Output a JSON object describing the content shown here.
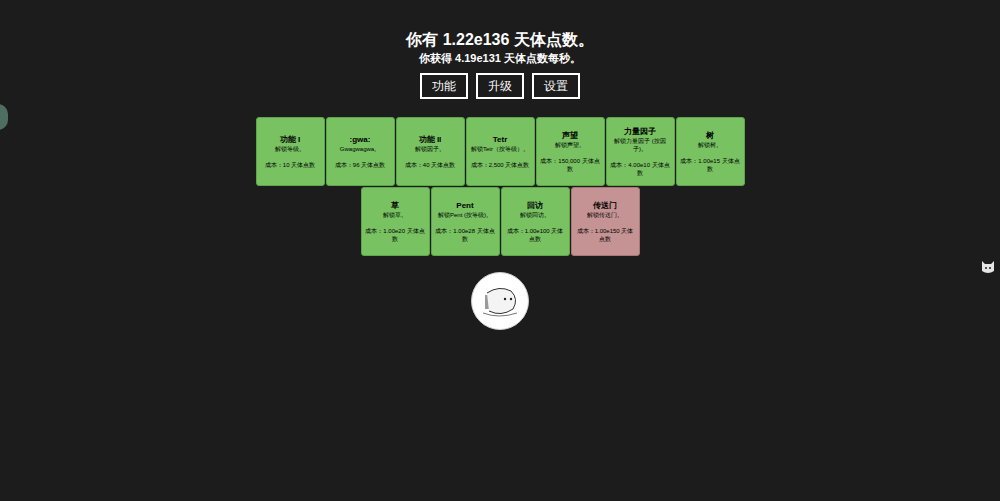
{
  "header": {
    "points": "你有 1.22e136 天体点数。",
    "rate": "你获得 4.19e131 天体点数每秒。"
  },
  "tabs": [
    {
      "label": "功能",
      "selected": false
    },
    {
      "label": "升级",
      "selected": false
    },
    {
      "label": "设置",
      "selected": false
    }
  ],
  "upgrades": [
    {
      "title": "功能 I",
      "description": "解锁等级。",
      "cost": "成本：10 天体点数",
      "bought": true
    },
    {
      "title": ":gwa:",
      "description": "Gwagwagwa。",
      "cost": "成本：96 天体点数",
      "bought": true
    },
    {
      "title": "功能 II",
      "description": "解锁因子。",
      "cost": "成本：40 天体点数",
      "bought": true
    },
    {
      "title": "Tetr",
      "description": "解锁Tetr（按等级）。",
      "cost": "成本：2,500 天体点数",
      "bought": true
    },
    {
      "title": "声望",
      "description": "解锁声望。",
      "cost": "成本：150,000 天体点数",
      "bought": true
    },
    {
      "title": "力量因子",
      "description": "解锁力量因子 (按因子)。",
      "cost": "成本：4.00e10 天体点数",
      "bought": true
    },
    {
      "title": "树",
      "description": "解锁树。",
      "cost": "成本：1.00e15 天体点数",
      "bought": true
    },
    {
      "title": "草",
      "description": "解锁草。",
      "cost": "成本：1.00e20 天体点数",
      "bought": true
    },
    {
      "title": "Pent",
      "description": "解锁Pent (按等级)。",
      "cost": "成本：1.00e28 天体点数",
      "bought": true
    },
    {
      "title": "回访",
      "description": "解锁回访。",
      "cost": "成本：1.00e100 天体点数",
      "bought": true
    },
    {
      "title": "传送门",
      "description": "解锁传送门。",
      "cost": "成本：1.00e150 天体点数",
      "bought": false
    }
  ]
}
